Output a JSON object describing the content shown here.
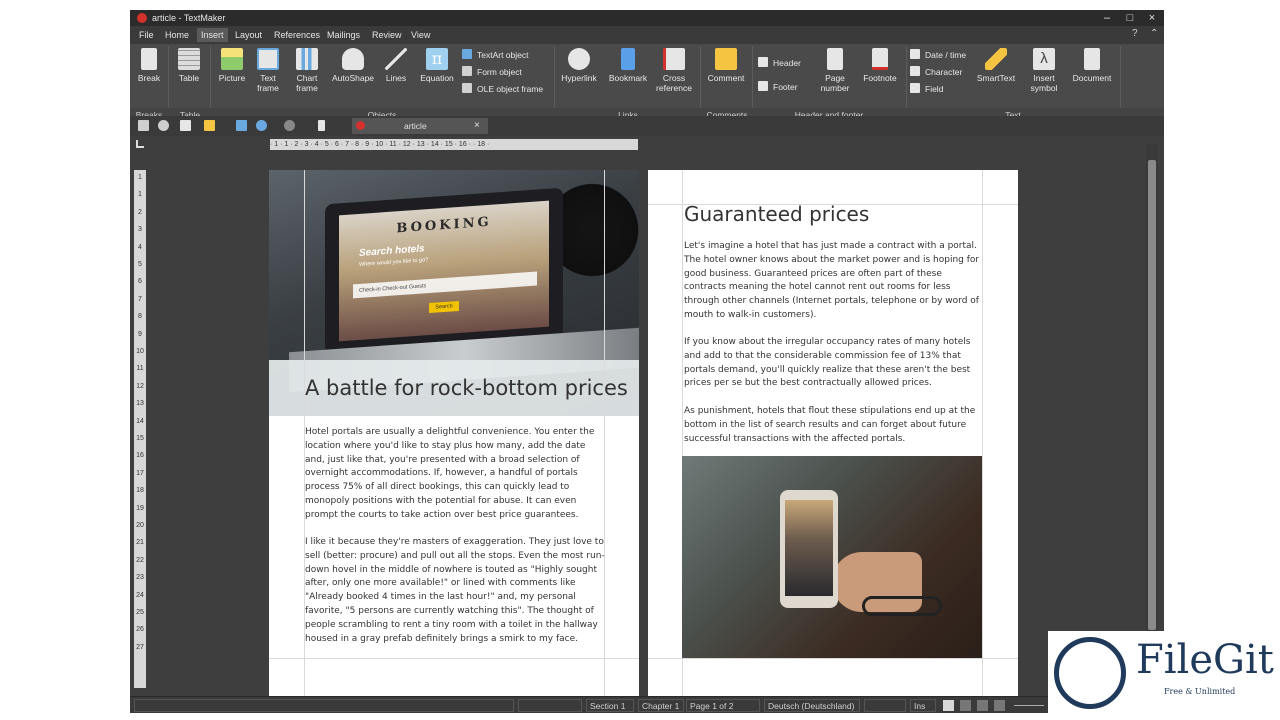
{
  "window": {
    "title": "article - TextMaker",
    "min_glyph": "–",
    "max_glyph": "□",
    "close_glyph": "×"
  },
  "menu": {
    "items": [
      "File",
      "Home",
      "Insert",
      "Layout",
      "References",
      "Mailings",
      "Review",
      "View"
    ],
    "active": "Insert",
    "help_glyph": "?",
    "collapse_glyph": "⌃"
  },
  "ribbon": {
    "breaks": "Break",
    "table": "Table",
    "picture": "Picture",
    "text_frame": "Text frame",
    "chart_frame": "Chart frame",
    "autoshape": "AutoShape",
    "lines": "Lines",
    "equation": "Equation",
    "textart": "TextArt object",
    "form_object": "Form object",
    "ole_frame": "OLE object frame",
    "hyperlink": "Hyperlink",
    "bookmark": "Bookmark",
    "cross_reference": "Cross reference",
    "comment": "Comment",
    "header": "Header",
    "footer": "Footer",
    "page_number": "Page number",
    "footnote": "Footnote",
    "date_time": "Date / time",
    "character": "Character",
    "field": "Field",
    "smarttext": "SmartText",
    "insert_symbol": "Insert symbol",
    "document": "Document",
    "groups": {
      "breaks": "Breaks",
      "table": "Table",
      "objects": "Objects",
      "links": "Links",
      "comments": "Comments",
      "header_footer": "Header and footer",
      "text": "Text"
    },
    "accent_colors": {
      "break": "#e6e6e6",
      "picture": "#8fcb6a",
      "chart": "#6aa8e0",
      "autoshape": "#e6e6e6",
      "equation": "#9fd0f0",
      "hyperlink": "#e6e6e6",
      "bookmark": "#5aa0e8",
      "comment": "#f5c542",
      "smarttext": "#f5c542"
    }
  },
  "toolbar": {
    "doc_tab": "article",
    "tab_close": "×"
  },
  "ruler": {
    "h_ticks": "· 1 · 1 · 2 · 3 · 4 · 5 · 6 · 7 · 8 · 9 · 10 · 11 · 12 · 13 · 14 · 15 · 16 · · 18 ·",
    "v_ticks": [
      "1",
      "1",
      "2",
      "3",
      "4",
      "5",
      "6",
      "7",
      "8",
      "9",
      "10",
      "11",
      "12",
      "13",
      "14",
      "15",
      "16",
      "17",
      "18",
      "19",
      "20",
      "21",
      "22",
      "23",
      "24",
      "25",
      "26",
      "27"
    ]
  },
  "page1": {
    "photo_booking": "BOOKING",
    "photo_search": "Search hotels",
    "photo_search_sub": "Where would you like to go?",
    "photo_fields": "Check-in     Check-out     Guests",
    "photo_button": "Search",
    "heading": "A battle for rock-bottom prices",
    "para1": "Hotel portals are usually a delightful convenience. You enter the location where you'd like to stay plus how many, add the date and, just like that, you're presented with a broad selection of overnight accommodations. If, however, a handful of portals process 75% of all direct bookings, this can quickly lead to monopoly positions with the potential for abuse. It can even prompt the courts to take action over best price guarantees.",
    "para2": "I like it because they're masters of exaggeration. They just love to sell (better: procure) and pull out all the stops. Even the most run-down hovel in the middle of nowhere is touted as \"Highly sought after, only one more available!\" or lined with comments like \"Already booked 4 times in the last hour!\" and, my personal favorite, \"5 persons are currently watching this\". The thought of people scrambling to rent a tiny room with a toilet in the hallway housed in a gray prefab definitely brings a smirk to my face."
  },
  "page2": {
    "heading": "Guaranteed prices",
    "para1": "Let's imagine a hotel that has just made a contract with a portal. The hotel owner knows about the market power and is hoping for good business. Guaranteed prices are often part of these contracts meaning the hotel cannot rent out rooms for less through other channels (Internet portals, telephone or by word of mouth to walk-in customers).",
    "para2": "If you know about the irregular occupancy rates of many hotels and add to that the considerable commission fee of 13% that portals demand, you'll quickly realize that these aren't the best prices per se but the best contractually allowed prices.",
    "para3": "As punishment, hotels that flout these stipulations end up at the bottom in the list of search results and can forget about future successful transactions with the affected portals."
  },
  "status": {
    "section": "Section 1",
    "chapter": "Chapter 1",
    "page": "Page 1 of 2",
    "language": "Deutsch (Deutschland)",
    "mode": "Ins"
  },
  "watermark": {
    "brand": "FileGit",
    "tagline": "Free & Unlimited"
  }
}
